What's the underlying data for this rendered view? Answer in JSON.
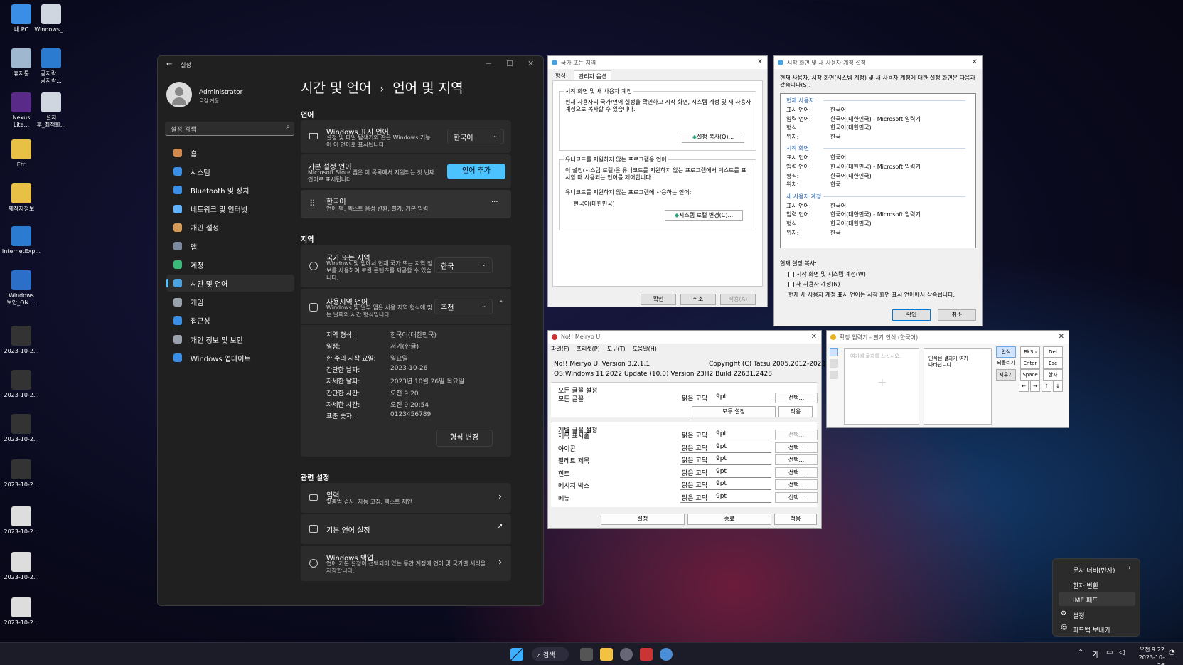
{
  "desktop": {
    "icons": [
      "내 PC",
      "Windows_...",
      "휴지통",
      "공지락...\n공지락...",
      "Nexus\nLite...",
      "설치\n후_최적화...",
      "Etc",
      "제작자정보",
      "InternetExp...",
      "Windows\n보안_ON ...",
      "2023-10-2...",
      "2023-10-2...",
      "2023-10-2...",
      "2023-10-2...",
      "2023-10-2...",
      "2023-10-2...",
      "2023-10-2..."
    ]
  },
  "settings": {
    "title": "설정",
    "user_name": "Administrator",
    "user_sub": "로컬 계정",
    "search_placeholder": "설정 검색",
    "nav": [
      "홈",
      "시스템",
      "Bluetooth 및 장치",
      "네트워크 및 인터넷",
      "개인 설정",
      "앱",
      "계정",
      "시간 및 언어",
      "게임",
      "접근성",
      "개인 정보 및 보안",
      "Windows 업데이트"
    ],
    "breadcrumb_parent": "시간 및 언어",
    "breadcrumb_sep": "›",
    "breadcrumb_current": "언어 및 지역",
    "lang_section": "언어",
    "display_lang": {
      "label": "Windows 표시 언어",
      "desc": "설정 및 파일 탐색기와 같은 Windows 기능이 이 언어로 표시됩니다.",
      "value": "한국어"
    },
    "pref_lang": {
      "label": "기본 설정 언어",
      "desc": "Microsoft Store 앱은 이 목록에서 지원되는 첫 번째 언어로 표시됩니다.",
      "button": "언어 추가"
    },
    "korean": {
      "label": "한국어",
      "desc": "언어 팩, 텍스트 음성 변환, 필기, 기본 입력",
      "more": "···"
    },
    "region_section": "지역",
    "country": {
      "label": "국가 또는 지역",
      "desc": "Windows 및 앱에서 현재 국가 또는 지역 정보를 사용하여 로컬 콘텐츠를 제공할 수 있습니다.",
      "value": "한국"
    },
    "regional_format": {
      "label": "사용지역 언어",
      "desc": "Windows 및 일부 앱은 사용 지역 형식에 맞는 날짜와 시간 형식입니다.",
      "value": "추천"
    },
    "formats": [
      [
        "지역 형식:",
        "한국어(대한민국)"
      ],
      [
        "일정:",
        "서기(한글)"
      ],
      [
        "한 주의 시작 요일:",
        "일요일"
      ],
      [
        "간단한 날짜:",
        "2023-10-26"
      ],
      [
        "자세한 날짜:",
        "2023년 10월 26일 목요일"
      ],
      [
        "간단한 시간:",
        "오전 9:20"
      ],
      [
        "자세한 시간:",
        "오전 9:20:54"
      ],
      [
        "표준 숫자:",
        "0123456789"
      ]
    ],
    "change_format": "형식 변경",
    "related_section": "관련 설정",
    "input": {
      "label": "입력",
      "desc": "맞춤법 검사, 자동 고침, 텍스트 제안"
    },
    "admin_lang": {
      "label": "기본 언어 설정"
    },
    "backup": {
      "label": "Windows 백업",
      "desc": "언어 기본 설정이 선택되어 있는 동안 계정에 언어 및 국가별 서식을 저장합니다."
    }
  },
  "region_dialog": {
    "title": "국가 또는 지역",
    "tabs": [
      "형식",
      "관리자 옵션"
    ],
    "g1_title": "시작 화면 및 새 사용자 계정",
    "g1_text": "현재 사용자의 국가/언어 설정을 확인하고 시작 화면, 시스템 계정 및 새 사용자 계정으로 복사할 수 있습니다.",
    "g1_button": "설정 복사(O)...",
    "g2_title": "유니코드를 지원하지 않는 프로그램용 언어",
    "g2_text": "이 설정(시스템 로캘)은 유니코드를 지원하지 않는 프로그램에서 텍스트를 표시할 때 사용되는 언어를 제어합니다.",
    "g2_label": "유니코드를 지원하지 않는 프로그램에 사용하는 언어:",
    "g2_value": "한국어(대한민국)",
    "g2_button": "시스템 로캘 변경(C)...",
    "ok": "확인",
    "cancel": "취소",
    "apply": "적용(A)"
  },
  "copy_dialog": {
    "title": "시작 화면 및 새 사용자 계정 설정",
    "intro": "현재 사용자, 시작 화면(시스템 계정) 및 새 사용자 계정에 대한 설정 화면은 다음과 같습니다(S).",
    "sections": [
      {
        "name": "현재 사용자",
        "rows": [
          [
            "표시 언어:",
            "한국어"
          ],
          [
            "입력 언어:",
            "한국어(대한민국) - Microsoft 입력기"
          ],
          [
            "형식:",
            "한국어(대한민국)"
          ],
          [
            "위치:",
            "한국"
          ]
        ]
      },
      {
        "name": "시작 화면",
        "rows": [
          [
            "표시 언어:",
            "한국어"
          ],
          [
            "입력 언어:",
            "한국어(대한민국) - Microsoft 입력기"
          ],
          [
            "형식:",
            "한국어(대한민국)"
          ],
          [
            "위치:",
            "한국"
          ]
        ]
      },
      {
        "name": "새 사용자 계정",
        "rows": [
          [
            "표시 언어:",
            "한국어"
          ],
          [
            "입력 언어:",
            "한국어(대한민국) - Microsoft 입력기"
          ],
          [
            "형식:",
            "한국어(대한민국)"
          ],
          [
            "위치:",
            "한국"
          ]
        ]
      }
    ],
    "copy_label": "현재 설정 복사:",
    "cb1": "시작 화면 및 시스템 계정(W)",
    "cb2": "새 사용자 계정(N)",
    "note": "현재 새 사용자 계정 표시 언어는 시작 화면 표시 언어에서 상속됩니다.",
    "ok": "확인",
    "cancel": "취소"
  },
  "meiryo": {
    "title": "No!! Meiryo UI",
    "menu": [
      "파일(F)",
      "프리셋(P)",
      "도구(T)",
      "도움말(H)"
    ],
    "version": "No!! Meiryo UI Version 3.2.1.1",
    "copyright": "Copyright (C) Tatsu 2005,2012-2023",
    "os": "OS:Windows 11 2022 Update (10.0) Version 23H2 Build 22631.2428",
    "all_group": "모든 글꼴 설정",
    "all_label": "모든 글꼴",
    "font": "맑은 고딕",
    "size": "9pt",
    "select": "선택...",
    "all_set": "모두 설정",
    "apply": "적용",
    "each_group": "개별 글꼴 설정",
    "rows": [
      "제목 표시줄",
      "아이콘",
      "팔레트 제목",
      "힌트",
      "메시지 박스",
      "메뉴"
    ],
    "set": "설정",
    "close": "종료"
  },
  "ime_pad": {
    "title": "확장 입력기 - 필기 인식 (한국어)",
    "placeholder": "여기에 글자를 쓰십시오.",
    "result": "인식된 결과가 여기 나타납니다.",
    "btn_recognize": "인식",
    "btn_undo": "되돌리기",
    "btn_clear": "지우기",
    "keys": [
      "BkSp",
      "Del",
      "Enter",
      "Esc",
      "Space",
      "한자",
      "←",
      "→",
      "↑",
      "↓"
    ]
  },
  "context_menu": {
    "items": [
      "문자 너비(반자)",
      "한자 변환",
      "IME 패드",
      "설정",
      "피드백 보내기"
    ]
  },
  "taskbar": {
    "search": "검색",
    "ime": "가",
    "time": "오전 9:22",
    "date": "2023-10-26"
  }
}
